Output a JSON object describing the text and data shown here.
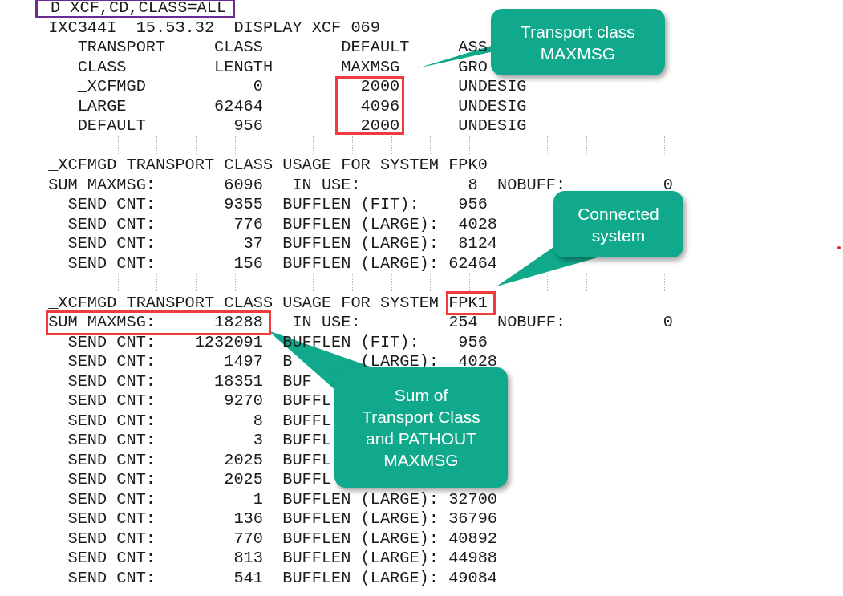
{
  "terminal": {
    "command": "D XCF,CD,CLASS=ALL",
    "message": "IXC344I  15.53.32  DISPLAY XCF 069"
  },
  "transport_table": {
    "header_rows": [
      [
        "TRANSPORT",
        "CLASS",
        "DEFAULT",
        "ASS"
      ],
      [
        "CLASS",
        "LENGTH",
        "MAXMSG",
        "GRO"
      ]
    ],
    "rows": [
      {
        "class": "_XCFMGD",
        "length": "0",
        "maxmsg": "2000",
        "group": "UNDESIG"
      },
      {
        "class": "LARGE",
        "length": "62464",
        "maxmsg": "4096",
        "group": "UNDESIG"
      },
      {
        "class": "DEFAULT",
        "length": "956",
        "maxmsg": "2000",
        "group": "UNDESIG"
      }
    ]
  },
  "usage_reports": [
    {
      "title": "_XCFMGD TRANSPORT CLASS USAGE FOR SYSTEM",
      "system": "FPK0",
      "system_boxed": false,
      "summary": {
        "label": "SUM MAXMSG:",
        "value": "6096",
        "boxed": false,
        "in_use_label": "IN USE:",
        "in_use": "8",
        "nobuff_label": "NOBUFF:",
        "nobuff": "0"
      },
      "sends": [
        {
          "label": "SEND CNT:",
          "count": "9355",
          "buffer": "BUFFLEN (FIT):    956"
        },
        {
          "label": "SEND CNT:",
          "count": "776",
          "buffer": "BUFFLEN (LARGE):  4028"
        },
        {
          "label": "SEND CNT:",
          "count": "37",
          "buffer": "BUFFLEN (LARGE):  8124"
        },
        {
          "label": "SEND CNT:",
          "count": "156",
          "buffer": "BUFFLEN (LARGE): 62464"
        }
      ]
    },
    {
      "title": "_XCFMGD TRANSPORT CLASS USAGE FOR SYSTEM",
      "system": "FPK1",
      "system_boxed": true,
      "summary": {
        "label": "SUM MAXMSG:",
        "value": "18288",
        "boxed": true,
        "in_use_label": "IN USE:",
        "in_use": "254",
        "nobuff_label": "NOBUFF:",
        "nobuff": "0"
      },
      "sends": [
        {
          "label": "SEND CNT:",
          "count": "1232091",
          "buffer": "BUFFLEN (FIT):    956"
        },
        {
          "label": "SEND CNT:",
          "count": "1497",
          "buffer": "B       (LARGE):  4028"
        },
        {
          "label": "SEND CNT:",
          "count": "18351",
          "buffer": "BUF"
        },
        {
          "label": "SEND CNT:",
          "count": "9270",
          "buffer": "BUFFL"
        },
        {
          "label": "SEND CNT:",
          "count": "8",
          "buffer": "BUFFL"
        },
        {
          "label": "SEND CNT:",
          "count": "3",
          "buffer": "BUFFL"
        },
        {
          "label": "SEND CNT:",
          "count": "2025",
          "buffer": "BUFFL"
        },
        {
          "label": "SEND CNT:",
          "count": "2025",
          "buffer": "BUFFL"
        },
        {
          "label": "SEND CNT:",
          "count": "1",
          "buffer": "BUFFLEN (LARGE): 32700"
        },
        {
          "label": "SEND CNT:",
          "count": "136",
          "buffer": "BUFFLEN (LARGE): 36796"
        },
        {
          "label": "SEND CNT:",
          "count": "770",
          "buffer": "BUFFLEN (LARGE): 40892"
        },
        {
          "label": "SEND CNT:",
          "count": "813",
          "buffer": "BUFFLEN (LARGE): 44988"
        },
        {
          "label": "SEND CNT:",
          "count": "541",
          "buffer": "BUFFLEN (LARGE): 49084"
        }
      ]
    }
  ],
  "callouts": [
    {
      "text": "Transport class\nMAXMSG"
    },
    {
      "text": "Connected\nsystem"
    },
    {
      "text": "Sum of\nTransport Class\nand PATHOUT\nMAXMSG"
    }
  ]
}
